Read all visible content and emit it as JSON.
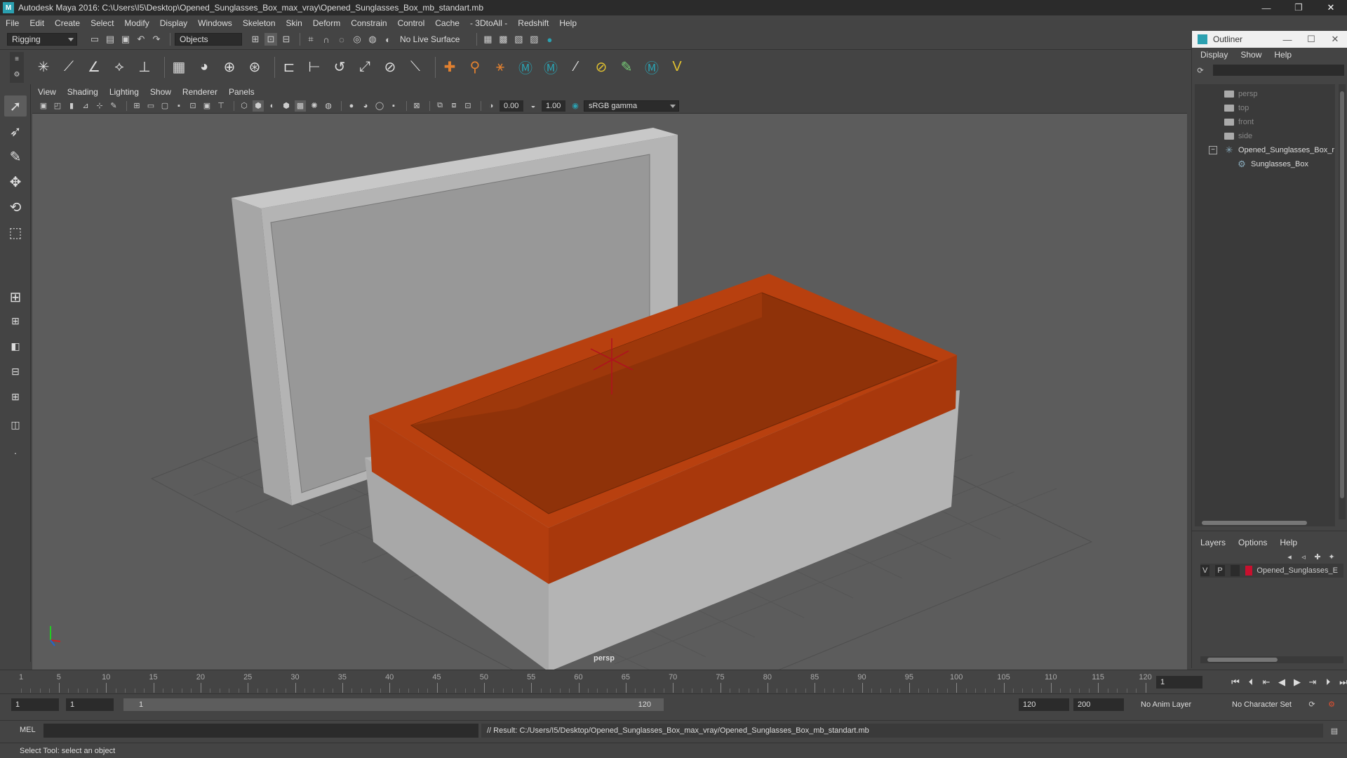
{
  "window": {
    "title": "Autodesk Maya 2016: C:\\Users\\I5\\Desktop\\Opened_Sunglasses_Box_max_vray\\Opened_Sunglasses_Box_mb_standart.mb",
    "minimize": "—",
    "restore": "❐",
    "close": "✕"
  },
  "menubar": [
    "File",
    "Edit",
    "Create",
    "Select",
    "Modify",
    "Display",
    "Windows",
    "Skeleton",
    "Skin",
    "Deform",
    "Constrain",
    "Control",
    "Cache",
    "- 3DtoAll -",
    "Redshift",
    "Help"
  ],
  "statusline": {
    "menuset": "Rigging",
    "selection_mode": "Objects",
    "live_surface": "No Live Surface"
  },
  "viewport": {
    "menus": [
      "View",
      "Shading",
      "Lighting",
      "Show",
      "Renderer",
      "Panels"
    ],
    "exposure": "0.00",
    "gamma": "1.00",
    "color_space": "sRGB gamma",
    "camera_label": "persp"
  },
  "outliner": {
    "title": "Outliner",
    "menus": [
      "Display",
      "Show",
      "Help"
    ],
    "items": [
      {
        "label": "persp",
        "type": "camera"
      },
      {
        "label": "top",
        "type": "camera"
      },
      {
        "label": "front",
        "type": "camera"
      },
      {
        "label": "side",
        "type": "camera"
      },
      {
        "label": "Opened_Sunglasses_Box_r",
        "type": "group"
      },
      {
        "label": "Sunglasses_Box",
        "type": "mesh"
      }
    ]
  },
  "layers": {
    "menus": [
      "Layers",
      "Options",
      "Help"
    ],
    "row": {
      "v": "V",
      "p": "P",
      "name": "Opened_Sunglasses_E",
      "color": "#c8102e"
    }
  },
  "timeslider": {
    "ticks": [
      "5",
      "10",
      "15",
      "20",
      "25",
      "30",
      "35",
      "40",
      "45",
      "50",
      "55",
      "60",
      "65",
      "70",
      "75",
      "80",
      "85",
      "90",
      "95",
      "100",
      "105",
      "110",
      "115",
      "120"
    ],
    "start_label": "1",
    "current_frame": "1"
  },
  "range": {
    "start": "1",
    "playback_start": "1",
    "bar_start": "1",
    "bar_end": "120",
    "playback_end": "120",
    "end": "200",
    "anim_layer": "No Anim Layer",
    "character_set": "No Character Set"
  },
  "command": {
    "lang": "MEL",
    "result": "// Result: C:/Users/I5/Desktop/Opened_Sunglasses_Box_max_vray/Opened_Sunglasses_Box_mb_standart.mb"
  },
  "helpline": "Select Tool: select an object",
  "colors": {
    "box_interior": "#b8400f",
    "box_white": "#b0b0b0",
    "accent": "#2ba0b0"
  }
}
